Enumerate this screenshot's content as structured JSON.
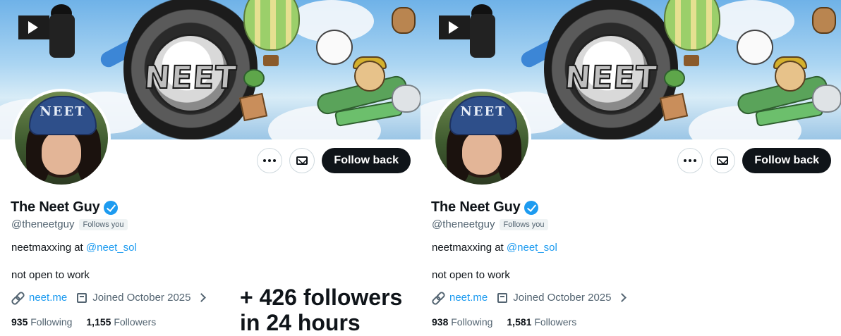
{
  "profiles": [
    {
      "name": "The Neet Guy",
      "handle": "@theneetguy",
      "follows_you": "Follows you",
      "bio_prefix": "neetmaxxing at",
      "bio_mention": "@neet_sol",
      "bio_line2": "not open to work",
      "link": "neet.me",
      "joined": "Joined October 2025",
      "following_count": "935",
      "following_label": "Following",
      "followers_count": "1,155",
      "followers_label": "Followers",
      "follow_button": "Follow back",
      "banner_logo": "NEET",
      "hat_text": "NEET"
    },
    {
      "name": "The Neet Guy",
      "handle": "@theneetguy",
      "follows_you": "Follows you",
      "bio_prefix": "neetmaxxing at",
      "bio_mention": "@neet_sol",
      "bio_line2": "not open to work",
      "link": "neet.me",
      "joined": "Joined October 2025",
      "following_count": "938",
      "following_label": "Following",
      "followers_count": "1,581",
      "followers_label": "Followers",
      "follow_button": "Follow back",
      "banner_logo": "NEET",
      "hat_text": "NEET"
    }
  ],
  "overlay": {
    "line1": "+ 426 followers",
    "line2": "in 24 hours"
  },
  "icons": {
    "more": "more-dots-icon",
    "message": "mail-icon",
    "verified": "verified-badge-icon",
    "link": "link-icon",
    "calendar": "calendar-icon",
    "chevron": "chevron-right-icon"
  },
  "colors": {
    "accent": "#1d9bf0",
    "text": "#0f1419",
    "muted": "#536471",
    "button": "#0f1419"
  }
}
